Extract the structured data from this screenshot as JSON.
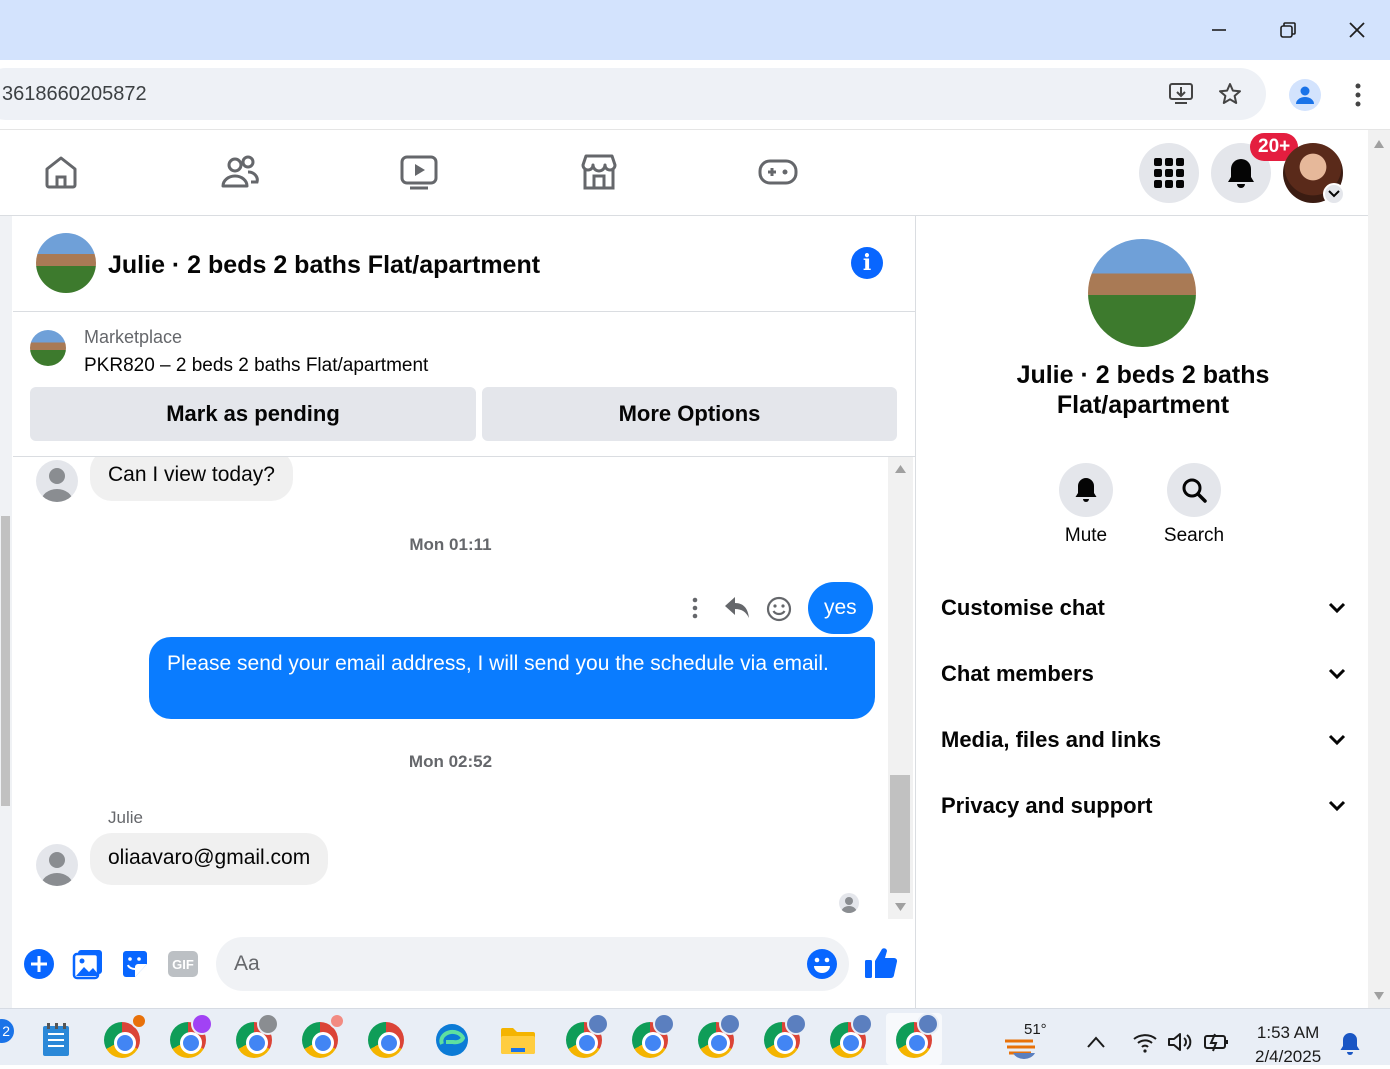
{
  "browser": {
    "url_fragment": "3618660205872",
    "window_controls": [
      "minimize-icon",
      "restore-icon",
      "close-icon"
    ]
  },
  "fb_nav": {
    "tabs": [
      "home-icon",
      "friends-icon",
      "watch-icon",
      "marketplace-icon",
      "gaming-icon"
    ],
    "notif_badge": "20+"
  },
  "conversation": {
    "title": "Julie · 2 beds 2 baths Flat/apartment",
    "marketplace_label": "Marketplace",
    "listing": "PKR820 – 2 beds 2 baths Flat/apartment",
    "mark_pending": "Mark as pending",
    "more_options": "More Options"
  },
  "messages": {
    "incoming_1": "Can I view today?",
    "timestamp_1": "Mon 01:11",
    "outgoing_1": "yes",
    "outgoing_2": "Please send your email address, I will send you the schedule via email.",
    "timestamp_2": "Mon 02:52",
    "sender_name": "Julie",
    "incoming_2": "oliaavaro@gmail.com"
  },
  "composer": {
    "placeholder": "Aa",
    "gif_label": "GIF"
  },
  "right_panel": {
    "title": "Julie · 2 beds 2 baths Flat/apartment",
    "mute_label": "Mute",
    "search_label": "Search",
    "sections": [
      "Customise chat",
      "Chat members",
      "Media, files and links",
      "Privacy and support"
    ]
  },
  "taskbar": {
    "left_badge": "2",
    "weather_temp": "51°",
    "time": "1:53 AM",
    "date": "2/4/2025"
  },
  "colors": {
    "messenger_blue": "#0a7cff",
    "fb_blue": "#0866ff",
    "badge_red": "#e41e3f",
    "chrome_titlebar": "#d3e3fd"
  }
}
